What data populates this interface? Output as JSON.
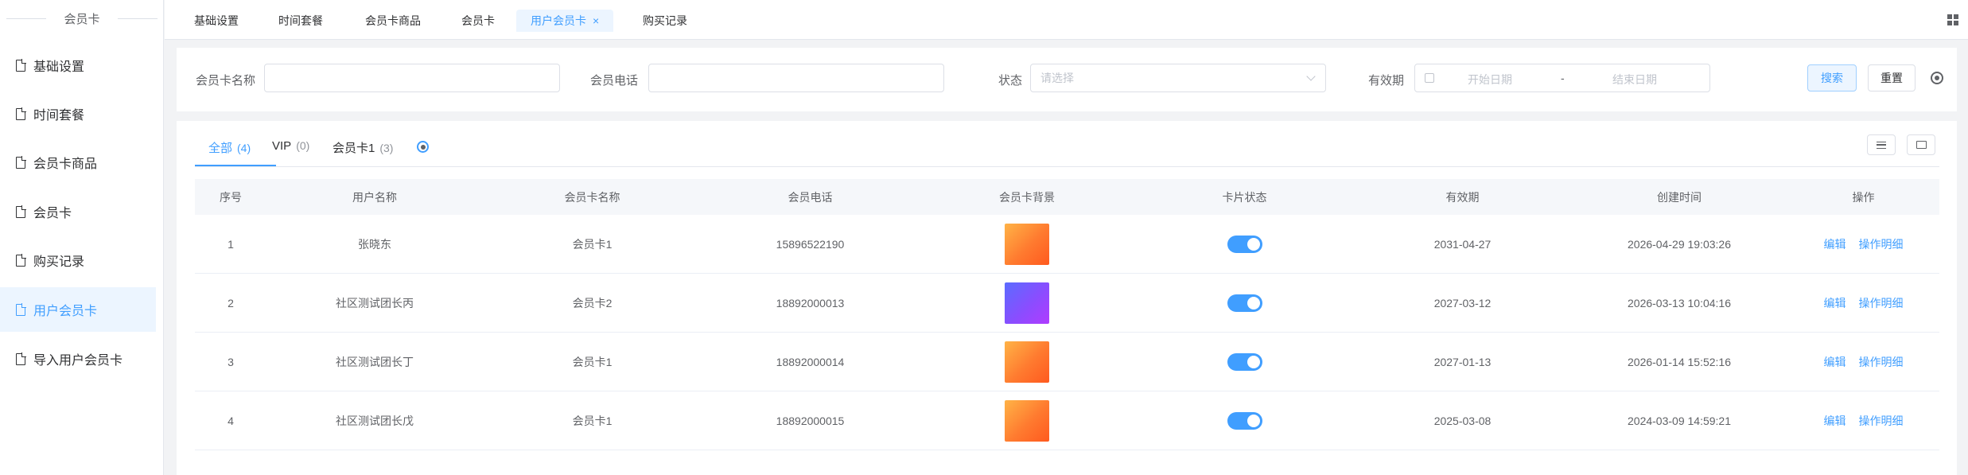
{
  "sidebar": {
    "title": "会员卡",
    "items": [
      {
        "label": "基础设置"
      },
      {
        "label": "时间套餐"
      },
      {
        "label": "会员卡商品"
      },
      {
        "label": "会员卡"
      },
      {
        "label": "购买记录"
      },
      {
        "label": "用户会员卡"
      },
      {
        "label": "导入用户会员卡"
      }
    ]
  },
  "tabs": [
    {
      "label": "基础设置"
    },
    {
      "label": "时间套餐"
    },
    {
      "label": "会员卡商品"
    },
    {
      "label": "会员卡"
    },
    {
      "label": "用户会员卡",
      "close": "×"
    },
    {
      "label": "购买记录"
    }
  ],
  "search": {
    "card_name_label": "会员卡名称",
    "card_name_value": "",
    "phone_label": "会员电话",
    "phone_value": "",
    "status_label": "状态",
    "status_placeholder": "请选择",
    "validity_label": "有效期",
    "start_placeholder": "开始日期",
    "range_sep": "-",
    "end_placeholder": "结束日期",
    "search_button": "搜索",
    "reset_button": "重置"
  },
  "subtabs": [
    {
      "label": "全部",
      "count": "(4)"
    },
    {
      "label": "VIP",
      "count": "(0)"
    },
    {
      "label": "会员卡1",
      "count": "(3)"
    }
  ],
  "table": {
    "columns": [
      "序号",
      "用户名称",
      "会员卡名称",
      "会员电话",
      "会员卡背景",
      "卡片状态",
      "有效期",
      "创建时间",
      "操作"
    ],
    "rows": [
      {
        "no": "1",
        "user": "张晓东",
        "card": "会员卡1",
        "phone": "15896522190",
        "bg": "orange",
        "enabled": true,
        "validity": "2031-04-27",
        "created": "2026-04-29 19:03:26",
        "edit": "编辑",
        "detail": "操作明细"
      },
      {
        "no": "2",
        "user": "社区测试团长丙",
        "card": "会员卡2",
        "phone": "18892000013",
        "bg": "purple",
        "enabled": true,
        "validity": "2027-03-12",
        "created": "2026-03-13 10:04:16",
        "edit": "编辑",
        "detail": "操作明细"
      },
      {
        "no": "3",
        "user": "社区测试团长丁",
        "card": "会员卡1",
        "phone": "18892000014",
        "bg": "orange",
        "enabled": true,
        "validity": "2027-01-13",
        "created": "2026-01-14 15:52:16",
        "edit": "编辑",
        "detail": "操作明细"
      },
      {
        "no": "4",
        "user": "社区测试团长戊",
        "card": "会员卡1",
        "phone": "18892000015",
        "bg": "orange",
        "enabled": true,
        "validity": "2025-03-08",
        "created": "2024-03-09 14:59:21",
        "edit": "编辑",
        "detail": "操作明细"
      }
    ]
  },
  "colors": {
    "accent": "#409eff",
    "accent_light": "#ecf5ff",
    "card_bg_orange": "#ff8a3d",
    "card_bg_purple": "#8a4dff"
  },
  "icons": [
    "file-icon",
    "close-icon",
    "grid-icon",
    "chevron-down-icon",
    "calendar-icon",
    "settings-gear-icon",
    "column-settings-icon",
    "folder-icon"
  ]
}
